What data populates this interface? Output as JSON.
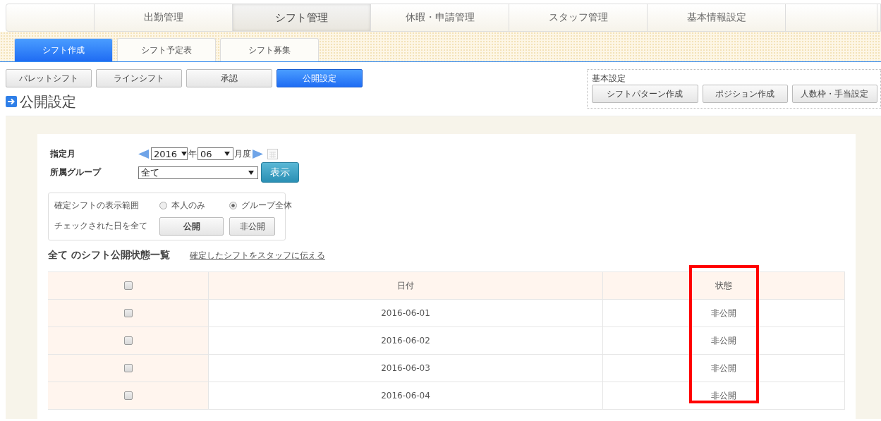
{
  "main_nav": [
    {
      "label": "出勤管理",
      "selected": false
    },
    {
      "label": "シフト管理",
      "selected": true
    },
    {
      "label": "休暇・申請管理",
      "selected": false
    },
    {
      "label": "スタッフ管理",
      "selected": false
    },
    {
      "label": "基本情報設定",
      "selected": false
    }
  ],
  "sub_tabs": [
    {
      "label": "シフト作成",
      "selected": true
    },
    {
      "label": "シフト予定表",
      "selected": false
    },
    {
      "label": "シフト募集",
      "selected": false
    }
  ],
  "mode_buttons": [
    {
      "label": "パレットシフト",
      "selected": false
    },
    {
      "label": "ラインシフト",
      "selected": false
    },
    {
      "label": "承認",
      "selected": false
    },
    {
      "label": "公開設定",
      "selected": true
    }
  ],
  "basic_settings": {
    "title": "基本設定",
    "buttons": [
      "シフトパターン作成",
      "ポジション作成",
      "人数枠・手当設定"
    ]
  },
  "page_title": "公開設定",
  "filters": {
    "month_label": "指定月",
    "year": "2016",
    "year_unit": "年",
    "month": "06",
    "month_unit": "月度",
    "group_label": "所属グループ",
    "group": "全て",
    "show_button": "表示"
  },
  "publish_box": {
    "range_label": "確定シフトの表示範囲",
    "range_options": [
      {
        "label": "本人のみ",
        "selected": false
      },
      {
        "label": "グループ全体",
        "selected": true
      }
    ],
    "bulk_label": "チェックされた日を全て",
    "bulk_buttons": [
      "公開",
      "非公開"
    ]
  },
  "list_title": "全て のシフト公開状態一覧",
  "notify_link": "確定したシフトをスタッフに伝える",
  "table": {
    "select_all_checked": false,
    "columns": [
      "日付",
      "状態"
    ],
    "rows": [
      {
        "checked": false,
        "date": "2016-06-01",
        "status": "非公開"
      },
      {
        "checked": false,
        "date": "2016-06-02",
        "status": "非公開"
      },
      {
        "checked": false,
        "date": "2016-06-03",
        "status": "非公開"
      },
      {
        "checked": false,
        "date": "2016-06-04",
        "status": "非公開"
      }
    ]
  }
}
